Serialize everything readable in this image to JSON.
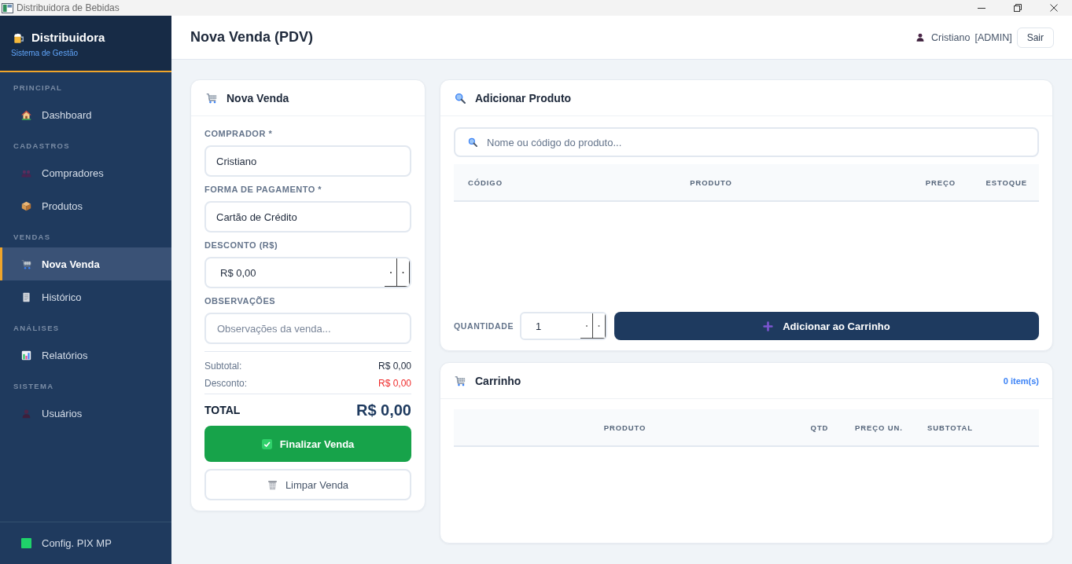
{
  "window": {
    "title": "Distribuidora de Bebidas"
  },
  "sidebar": {
    "brand": {
      "name": "Distribuidora",
      "subtitle": "Sistema de Gestão"
    },
    "sections": [
      {
        "title": "PRINCIPAL",
        "items": [
          {
            "label": "Dashboard",
            "selected": false
          }
        ]
      },
      {
        "title": "CADASTROS",
        "items": [
          {
            "label": "Compradores",
            "selected": false
          },
          {
            "label": "Produtos",
            "selected": false
          }
        ]
      },
      {
        "title": "VENDAS",
        "items": [
          {
            "label": "Nova Venda",
            "selected": true
          },
          {
            "label": "Histórico",
            "selected": false
          }
        ]
      },
      {
        "title": "ANÁLISES",
        "items": [
          {
            "label": "Relatórios",
            "selected": false
          }
        ]
      },
      {
        "title": "SISTEMA",
        "items": [
          {
            "label": "Usuários",
            "selected": false
          }
        ]
      }
    ],
    "footer_item": {
      "label": "Config. PIX MP"
    }
  },
  "header": {
    "title": "Nova Venda (PDV)",
    "user_name": "Cristiano",
    "user_role": "[ADMIN]",
    "logout_button": "Sair"
  },
  "sale_panel": {
    "title": "Nova Venda",
    "fields": [
      {
        "label": "COMPRADOR *",
        "kind": "select",
        "value": "Cristiano"
      },
      {
        "label": "FORMA DE PAGAMENTO *",
        "kind": "select",
        "value": "Cartão de Crédito"
      },
      {
        "label": "DESCONTO (R$)",
        "kind": "number",
        "value": "R$ 0,00"
      },
      {
        "label": "OBSERVAÇÕES",
        "kind": "text",
        "placeholder": "Observações da venda..."
      }
    ],
    "summary": [
      {
        "label": "Subtotal:",
        "value": "R$ 0,00",
        "kind": "amount"
      },
      {
        "label": "Desconto:",
        "value": "R$ 0,00",
        "kind": "deduction"
      }
    ],
    "total": {
      "label": "TOTAL",
      "value": "R$ 0,00"
    },
    "buttons": [
      {
        "label": "Finalizar Venda",
        "kind": "confirm"
      },
      {
        "label": "Limpar Venda",
        "kind": "clear"
      }
    ]
  },
  "product_panel": {
    "title": "Adicionar Produto",
    "search": {
      "placeholder": "Nome ou código do produto..."
    },
    "table": {
      "columns": [
        "CÓDIGO",
        "PRODUTO",
        "PREÇO",
        "ESTOQUE"
      ]
    },
    "quantity": {
      "label": "QUANTIDADE",
      "value": "1"
    },
    "add_button": "Adicionar ao Carrinho"
  },
  "cart_panel": {
    "title": "Carrinho",
    "item_count": "0 item(s)",
    "table": {
      "columns": [
        "PRODUTO",
        "QTD",
        "PREÇO UN.",
        "SUBTOTAL"
      ]
    }
  }
}
